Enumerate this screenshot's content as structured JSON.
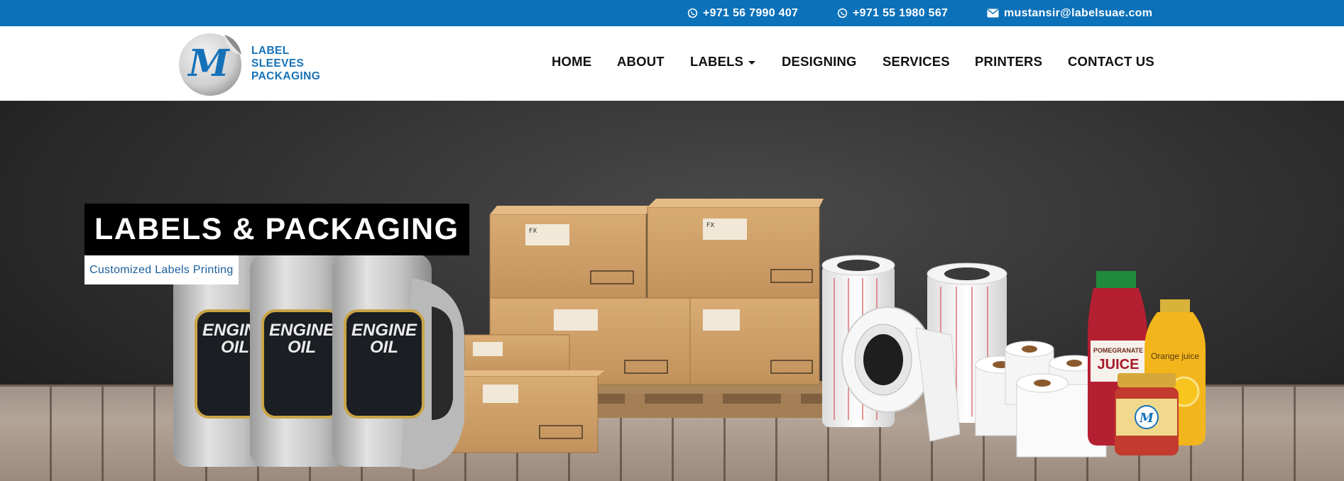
{
  "topbar": {
    "phone1": "+971 56 7990 407",
    "phone2": "+971 55 1980 567",
    "email": "mustansir@labelsuae.com",
    "icons": [
      "whatsapp-icon",
      "whatsapp-icon",
      "envelope-icon"
    ],
    "color": "#0b71b9"
  },
  "logo": {
    "mark": "M",
    "line1": "LABEL",
    "line2": "SLEEVES",
    "line3": "PACKAGING",
    "color": "#1672b8"
  },
  "nav": {
    "items": [
      {
        "label": "HOME"
      },
      {
        "label": "ABOUT"
      },
      {
        "label": "LABELS",
        "dropdown": true
      },
      {
        "label": "DESIGNING"
      },
      {
        "label": "SERVICES"
      },
      {
        "label": "PRINTERS"
      },
      {
        "label": "CONTACT US"
      }
    ]
  },
  "hero": {
    "title": "LABELS & PACKAGING",
    "subtitle": "Customized Labels Printing",
    "bottle_label_line1": "ENGINE",
    "bottle_label_line2": "OIL",
    "juice_brand": "POMEGRANATE",
    "juice_name": "JUICE",
    "orange_label": "Orange juice",
    "box_code": "FX"
  }
}
